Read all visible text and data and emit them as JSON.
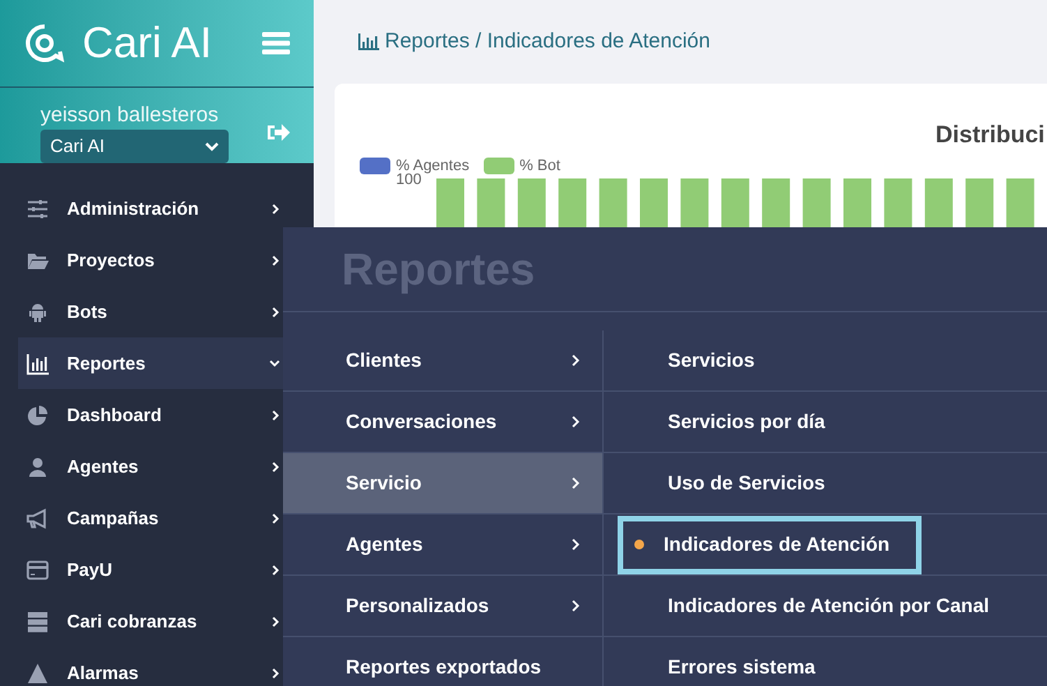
{
  "brand": {
    "name": "Cari AI"
  },
  "user": {
    "name": "yeisson ballesteros",
    "account": "Cari AI"
  },
  "sidebar": {
    "items": [
      {
        "label": "Administración",
        "selected": false,
        "expanded": false
      },
      {
        "label": "Proyectos",
        "selected": false,
        "expanded": false
      },
      {
        "label": "Bots",
        "selected": false,
        "expanded": false
      },
      {
        "label": "Reportes",
        "selected": true,
        "expanded": true
      },
      {
        "label": "Dashboard",
        "selected": false,
        "expanded": false
      },
      {
        "label": "Agentes",
        "selected": false,
        "expanded": false
      },
      {
        "label": "Campañas",
        "selected": false,
        "expanded": false
      },
      {
        "label": "PayU",
        "selected": false,
        "expanded": false
      },
      {
        "label": "Cari cobranzas",
        "selected": false,
        "expanded": false
      },
      {
        "label": "Alarmas",
        "selected": false,
        "expanded": false
      }
    ]
  },
  "breadcrumb": "Reportes / Indicadores de Atención",
  "chart_card": {
    "title": "Distribuci",
    "legend": [
      {
        "label": "% Agentes",
        "color": "#5470c6"
      },
      {
        "label": "% Bot",
        "color": "#91cc75"
      }
    ],
    "y_tick": "100"
  },
  "flyout": {
    "title": "Reportes",
    "categories": [
      {
        "label": "Clientes",
        "selected": false,
        "has_submenu": true
      },
      {
        "label": "Conversaciones",
        "selected": false,
        "has_submenu": true
      },
      {
        "label": "Servicio",
        "selected": true,
        "has_submenu": true
      },
      {
        "label": "Agentes",
        "selected": false,
        "has_submenu": true
      },
      {
        "label": "Personalizados",
        "selected": false,
        "has_submenu": true
      },
      {
        "label": "Reportes exportados",
        "selected": false,
        "has_submenu": false
      }
    ],
    "links": [
      {
        "label": "Servicios",
        "selected": false
      },
      {
        "label": "Servicios por día",
        "selected": false
      },
      {
        "label": "Uso de Servicios",
        "selected": false
      },
      {
        "label": "Indicadores de Atención",
        "selected": true
      },
      {
        "label": "Indicadores de Atención por Canal",
        "selected": false
      },
      {
        "label": "Errores sistema",
        "selected": false
      }
    ]
  }
}
